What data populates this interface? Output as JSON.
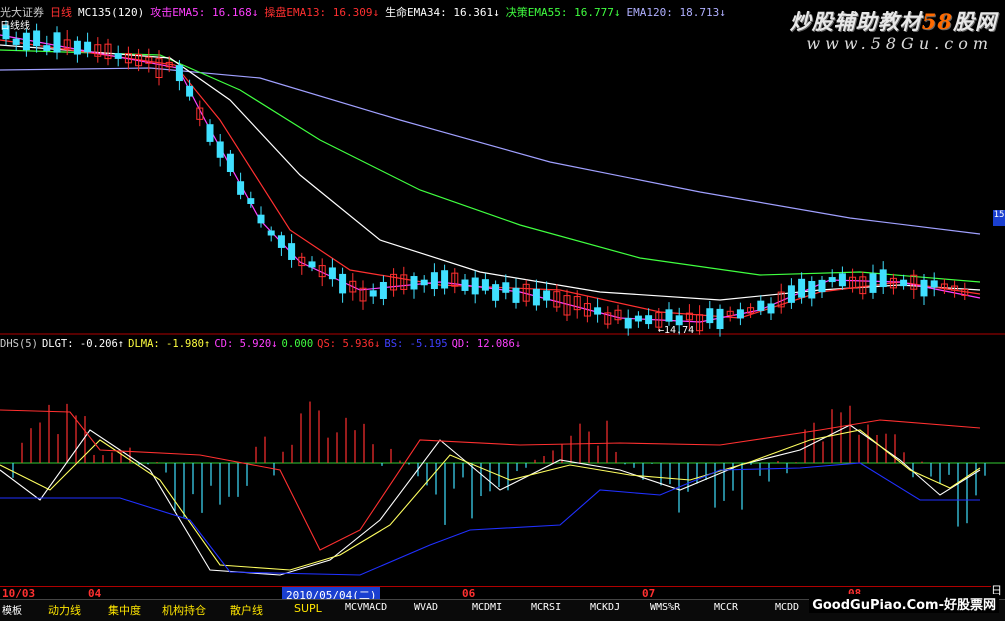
{
  "header": {
    "broker": "光大证券",
    "period": "日线",
    "ma_indicator": "MC135(120)",
    "lines": [
      {
        "label": "攻击EMA5: 16.168",
        "arrow": "↓",
        "color": "#ff40ff"
      },
      {
        "label": "操盘EMA13: 16.309",
        "arrow": "↓",
        "color": "#ff3030"
      },
      {
        "label": "生命EMA34: 16.361",
        "arrow": "↓",
        "color": "#ffffff"
      },
      {
        "label": "决策EMA55: 16.777",
        "arrow": "↓",
        "color": "#40ff40"
      },
      {
        "label": "EMA120: 18.713",
        "arrow": "↓",
        "color": "#b0b0ff"
      }
    ],
    "side_label": "日线线"
  },
  "indicator_header": {
    "name": "DHS(5)",
    "items": [
      {
        "label": "DLGT: -0.206",
        "arrow": "↑",
        "color": "#ffffff"
      },
      {
        "label": "DLMA: -1.980",
        "arrow": "↑",
        "color": "#ffff40"
      },
      {
        "label": "CD: 5.920",
        "arrow": "↓",
        "color": "#ff40ff"
      },
      {
        "label": "0.000",
        "arrow": "",
        "color": "#40ff40"
      },
      {
        "label": "QS: 5.936",
        "arrow": "↓",
        "color": "#ff3030"
      },
      {
        "label": "BS: -5.195",
        "arrow": "",
        "color": "#4040ff"
      },
      {
        "label": "QD: 12.086",
        "arrow": "↓",
        "color": "#ff40ff"
      }
    ]
  },
  "watermark": {
    "main_pre": "炒股辅助教材",
    "main_num": "58",
    "main_post": "股网",
    "url": "www.58Gu.com"
  },
  "annotation": {
    "low_price": "←14.74"
  },
  "right_tag": "15",
  "right_tag2": "日",
  "date_axis": {
    "labels": [
      "10/03",
      "04",
      "06",
      "07",
      "08"
    ],
    "cursor": "2010/05/04(二)"
  },
  "tabs": [
    {
      "label": "模板",
      "type": "w"
    },
    {
      "label": "动力线",
      "type": "y"
    },
    {
      "label": "集中度",
      "type": "y"
    },
    {
      "label": "机构持仓",
      "type": "y"
    },
    {
      "label": "散户线",
      "type": "y"
    },
    {
      "label": "SUPL",
      "type": "y"
    },
    {
      "label": "MCVMACD",
      "type": "w"
    },
    {
      "label": "WVAD",
      "type": "w"
    },
    {
      "label": "MCDMI",
      "type": "w"
    },
    {
      "label": "MCRSI",
      "type": "w"
    },
    {
      "label": "MCKDJ",
      "type": "w"
    },
    {
      "label": "WMS%R",
      "type": "w"
    },
    {
      "label": "MCCR",
      "type": "w"
    },
    {
      "label": "MCDD",
      "type": "w"
    }
  ],
  "footer_watermark": "GoodGuPiao.Com-好股票网",
  "colors": {
    "up": "#ff3030",
    "down": "#40e0ff",
    "ema5": "#ff40ff",
    "ema13": "#ff3030",
    "ema34": "#ffffff",
    "ema55": "#40ff40",
    "ema120": "#a0a0ff",
    "divider": "#b00000"
  }
}
